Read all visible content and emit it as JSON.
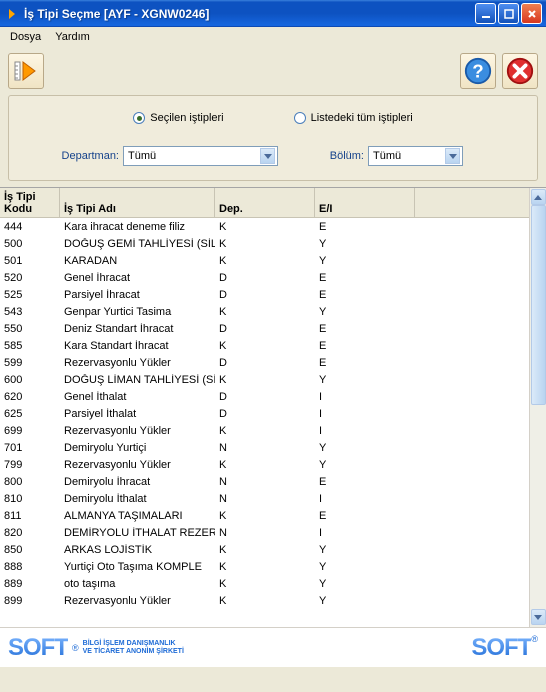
{
  "window": {
    "title": "İş Tipi Seçme [AYF - XGNW0246]"
  },
  "menu": {
    "file": "Dosya",
    "help": "Yardım"
  },
  "options": {
    "radio_selected": "Seçilen iştipleri",
    "radio_all": "Listedeki tüm iştipleri",
    "dept_label": "Departman:",
    "dept_value": "Tümü",
    "section_label": "Bölüm:",
    "section_value": "Tümü"
  },
  "table": {
    "headers": {
      "kod": "İş Tipi Kodu",
      "ad": "İş Tipi Adı",
      "dep": "Dep.",
      "ei": "E/I"
    },
    "rows": [
      {
        "kod": "444",
        "ad": "Kara ihracat deneme filiz",
        "dep": "K",
        "ei": "E"
      },
      {
        "kod": "500",
        "ad": "DOĞUŞ GEMİ TAHLİYESİ (SİLME",
        "dep": "K",
        "ei": "Y"
      },
      {
        "kod": "501",
        "ad": "KARADAN",
        "dep": "K",
        "ei": "Y"
      },
      {
        "kod": "520",
        "ad": "Genel İhracat",
        "dep": "D",
        "ei": "E"
      },
      {
        "kod": "525",
        "ad": "Parsiyel İhracat",
        "dep": "D",
        "ei": "E"
      },
      {
        "kod": "543",
        "ad": "Genpar Yurtici Tasima",
        "dep": "K",
        "ei": "Y"
      },
      {
        "kod": "550",
        "ad": "Deniz Standart İhracat",
        "dep": "D",
        "ei": "E"
      },
      {
        "kod": "585",
        "ad": "Kara Standart İhracat",
        "dep": "K",
        "ei": "E"
      },
      {
        "kod": "599",
        "ad": "Rezervasyonlu Yükler",
        "dep": "D",
        "ei": "E"
      },
      {
        "kod": "600",
        "ad": "DOĞUŞ LİMAN TAHLİYESİ (SİLM",
        "dep": "K",
        "ei": "Y"
      },
      {
        "kod": "620",
        "ad": "Genel İthalat",
        "dep": "D",
        "ei": "I"
      },
      {
        "kod": "625",
        "ad": "Parsiyel İthalat",
        "dep": "D",
        "ei": "I"
      },
      {
        "kod": "699",
        "ad": "Rezervasyonlu Yükler",
        "dep": "K",
        "ei": "I"
      },
      {
        "kod": "701",
        "ad": "Demiryolu Yurtiçi",
        "dep": "N",
        "ei": "Y"
      },
      {
        "kod": "799",
        "ad": "Rezervasyonlu Yükler",
        "dep": "K",
        "ei": "Y"
      },
      {
        "kod": "800",
        "ad": "Demiryolu İhracat",
        "dep": "N",
        "ei": "E"
      },
      {
        "kod": "810",
        "ad": "Demiryolu İthalat",
        "dep": "N",
        "ei": "I"
      },
      {
        "kod": "811",
        "ad": "ALMANYA TAŞIMALARI",
        "dep": "K",
        "ei": "E"
      },
      {
        "kod": "820",
        "ad": "DEMİRYOLU İTHALAT REZERVA",
        "dep": "N",
        "ei": "I"
      },
      {
        "kod": "850",
        "ad": "ARKAS LOJİSTİK",
        "dep": "K",
        "ei": "Y"
      },
      {
        "kod": "888",
        "ad": "Yurtiçi Oto Taşıma KOMPLE",
        "dep": "K",
        "ei": "Y"
      },
      {
        "kod": "889",
        "ad": "oto taşıma",
        "dep": "K",
        "ei": "Y"
      },
      {
        "kod": "899",
        "ad": "Rezervasyonlu Yükler",
        "dep": "K",
        "ei": "Y"
      }
    ]
  },
  "footer": {
    "brand": "SOFT",
    "tagline1": "BİLGİ İŞLEM DANIŞMANLIK",
    "tagline2": "VE TİCARET ANONİM ŞİRKETİ"
  }
}
